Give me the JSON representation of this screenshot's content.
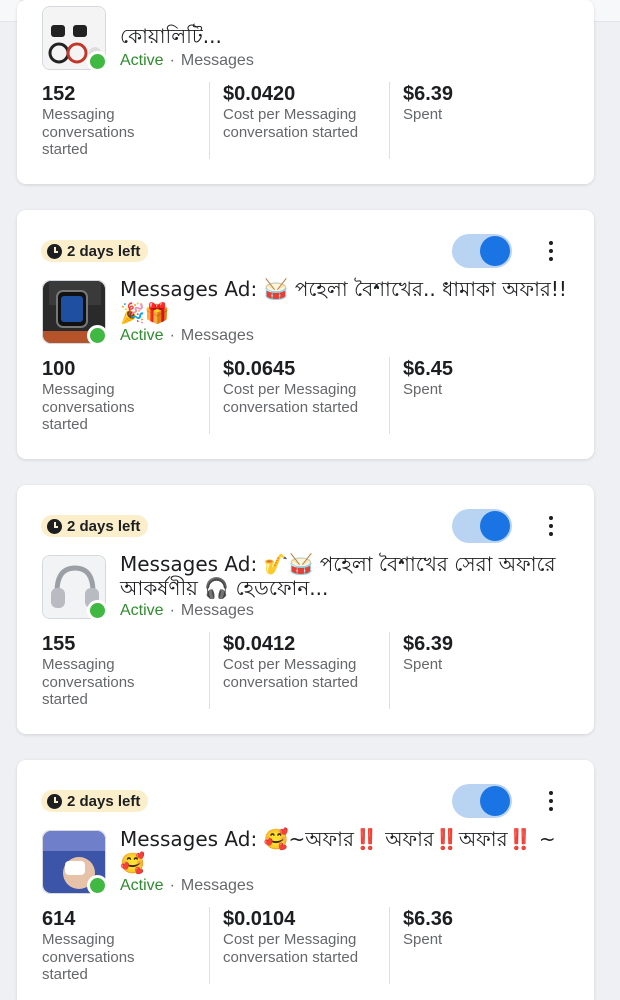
{
  "cards": [
    {
      "title": "কোয়ালিটি...",
      "status": "Active",
      "separator": "·",
      "type": "Messages",
      "metrics": [
        {
          "value": "152",
          "label": "Messaging conversations started"
        },
        {
          "value": "$0.0420",
          "label": "Cost per Messaging conversation started"
        },
        {
          "value": "$6.39",
          "label": "Spent"
        }
      ]
    },
    {
      "badge": "2 days left",
      "title": "Messages Ad: 🥁 পহেলা বৈশাখের.. ধামাকা অফার!!🎉🎁",
      "status": "Active",
      "separator": "·",
      "type": "Messages",
      "toggle_on": true,
      "metrics": [
        {
          "value": "100",
          "label": "Messaging conversations started"
        },
        {
          "value": "$0.0645",
          "label": "Cost per Messaging conversation started"
        },
        {
          "value": "$6.45",
          "label": "Spent"
        }
      ]
    },
    {
      "badge": "2 days left",
      "title": "Messages Ad: 🎷🥁 পহেলা বৈশাখের সেরা অফারে আকর্ষণীয় 🎧 হেডফোন...",
      "status": "Active",
      "separator": "·",
      "type": "Messages",
      "toggle_on": true,
      "metrics": [
        {
          "value": "155",
          "label": "Messaging conversations started"
        },
        {
          "value": "$0.0412",
          "label": "Cost per Messaging conversation started"
        },
        {
          "value": "$6.39",
          "label": "Spent"
        }
      ]
    },
    {
      "badge": "2 days left",
      "title": "Messages Ad: 🥰~অফার‼️ অফার‼️অফার‼️ ~🥰",
      "status": "Active",
      "separator": "·",
      "type": "Messages",
      "toggle_on": true,
      "metrics": [
        {
          "value": "614",
          "label": "Messaging conversations started"
        },
        {
          "value": "$0.0104",
          "label": "Cost per Messaging conversation started"
        },
        {
          "value": "$6.36",
          "label": "Spent"
        }
      ]
    }
  ],
  "icons": {
    "badge_icon": "clock-icon",
    "menu_icon": "more-vertical-icon",
    "status_icon": "active-dot-icon"
  },
  "colors": {
    "accent": "#1b74e4",
    "toggle_track": "#b9d3f3",
    "active_green": "#2e8b2e",
    "status_dot": "#3fb942",
    "badge_bg": "#fbeecb"
  }
}
